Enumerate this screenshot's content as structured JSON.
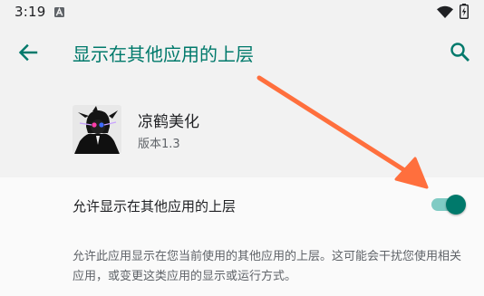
{
  "status_bar": {
    "time": "3:19",
    "notification_icon": "a-notification-icon",
    "wifi_icon": "wifi-icon",
    "battery_icon": "battery-charging-icon"
  },
  "app_bar": {
    "back_icon": "back-arrow-icon",
    "title": "显示在其他应用的上层",
    "search_icon": "search-icon"
  },
  "app_info": {
    "name": "凉鹤美化",
    "version": "版本1.3"
  },
  "permission": {
    "label": "允许显示在其他应用的上层",
    "enabled": true,
    "description": "允许此应用显示在您当前使用的其他应用的上层。这可能会干扰您使用相关应用，或变更这类应用的显示或运行方式。"
  },
  "colors": {
    "accent": "#00796b",
    "toggle_track": "#80cbc4",
    "annotation_arrow": "#ff6f3d"
  }
}
